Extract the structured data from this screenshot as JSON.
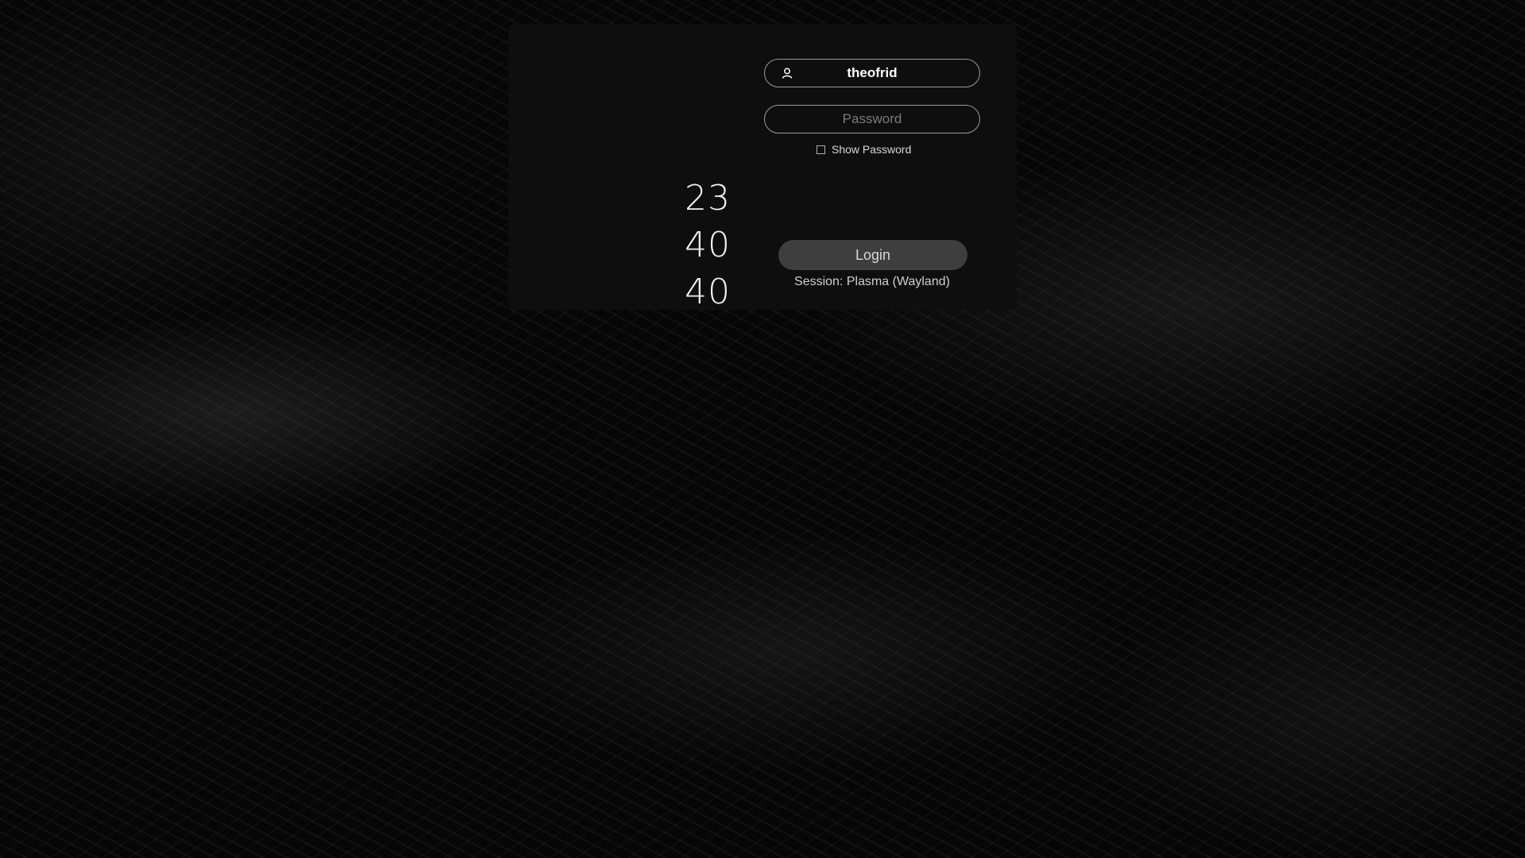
{
  "clock": {
    "hours": "23",
    "minutes": "40",
    "seconds": "40"
  },
  "login": {
    "username": "theofrid",
    "password_placeholder": "Password",
    "show_password_label": "Show Password",
    "show_password_checked": false,
    "login_label": "Login",
    "session_text": "Session: Plasma (Wayland)"
  },
  "icons": {
    "user": "user-icon"
  },
  "colors": {
    "background": "#060606",
    "panel": "#0e0e0e",
    "button": "#3e3e3e",
    "text": "#ffffff"
  }
}
